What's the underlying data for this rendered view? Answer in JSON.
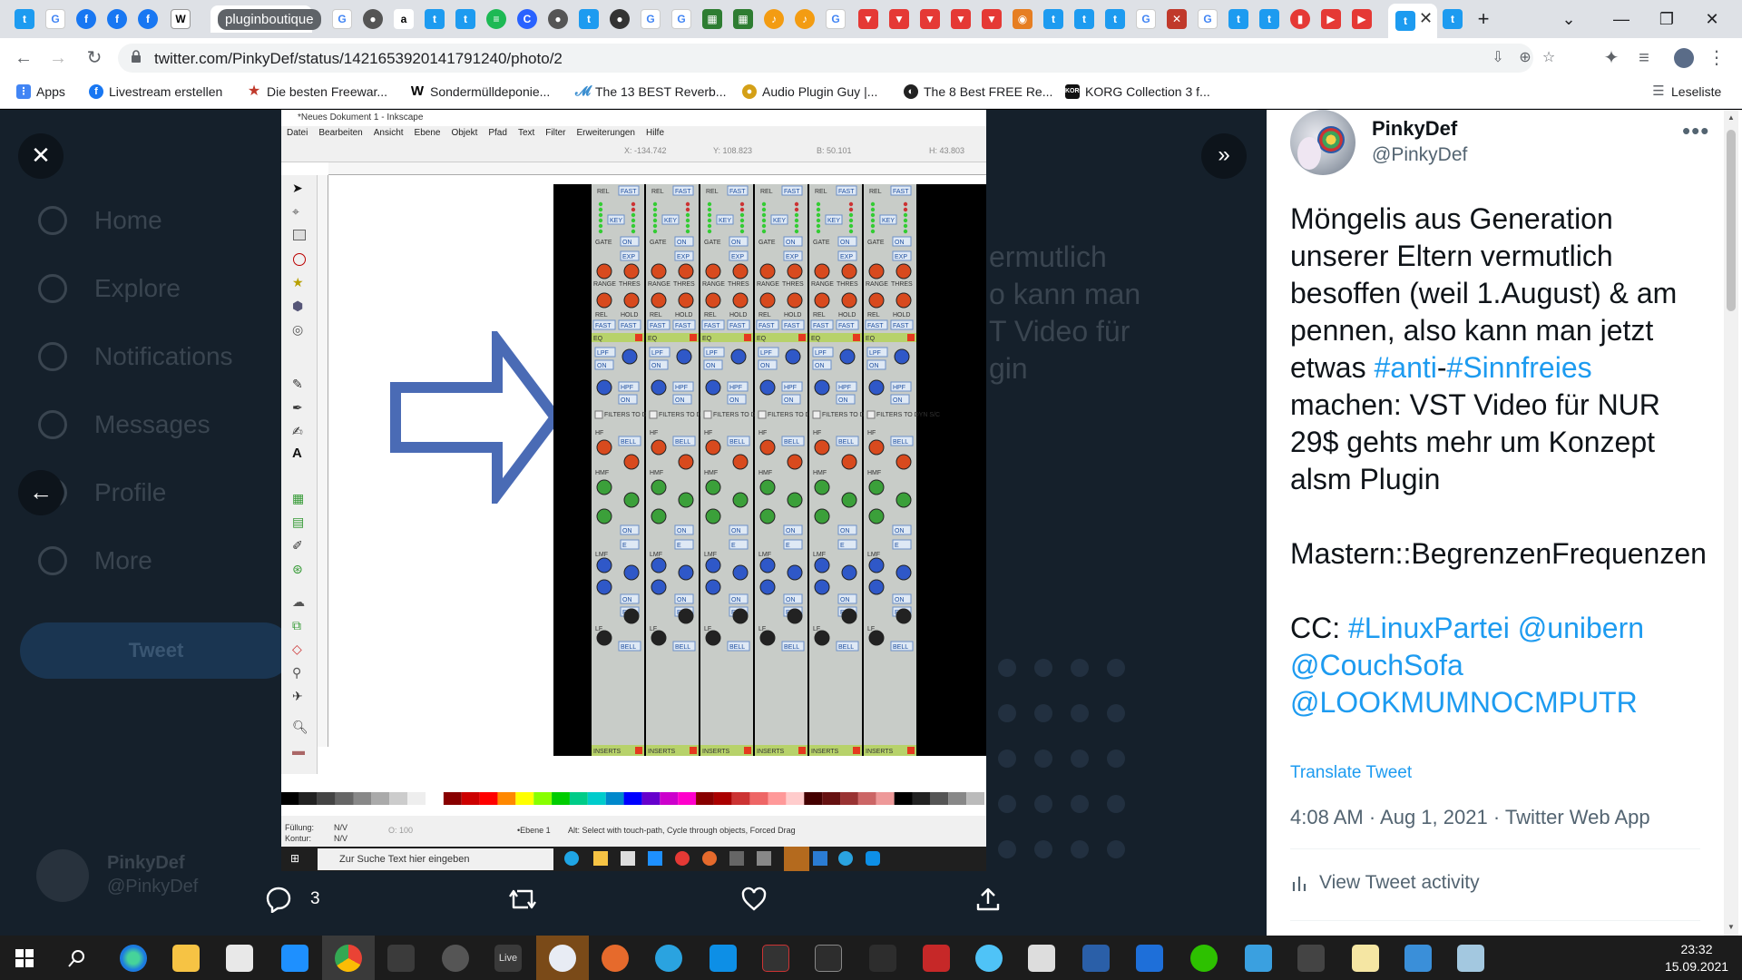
{
  "browser": {
    "active_tab_label": "pluginboutique",
    "url": "twitter.com/PinkyDef/status/1421653920141791240/photo/2",
    "bookmarks": [
      {
        "label": "Apps",
        "icon": "apps-grid-icon",
        "color": "#4285f4"
      },
      {
        "label": "Livestream erstellen",
        "icon": "facebook-icon",
        "color": "#1877f2"
      },
      {
        "label": "Die besten Freewar...",
        "icon": "star-icon",
        "color": "#c0392b"
      },
      {
        "label": "Sondermülldeponie...",
        "icon": "wikipedia-icon",
        "color": "#000000"
      },
      {
        "label": "The 13 BEST Reverb...",
        "icon": "brand-icon",
        "color": "#3b8ed0"
      },
      {
        "label": "Audio Plugin Guy |...",
        "icon": "brand-icon",
        "color": "#d4a017"
      },
      {
        "label": "The 8 Best FREE Re...",
        "icon": "brand-icon",
        "color": "#222222"
      },
      {
        "label": "KORG Collection 3 f...",
        "icon": "korg-icon",
        "color": "#111111"
      }
    ],
    "reading_list": "Leseliste"
  },
  "photo": {
    "inkscape_title": "*Neues Dokument 1 - Inkscape",
    "menu": [
      "Datei",
      "Bearbeiten",
      "Ansicht",
      "Ebene",
      "Objekt",
      "Pfad",
      "Text",
      "Filter",
      "Erweiterungen",
      "Hilfe"
    ],
    "ctrl_x": "X: -134.742",
    "ctrl_y": "Y: 108.823",
    "ctrl_b": "B: 50.101",
    "ctrl_h": "H: 43.803",
    "status_fill": "Füllung:",
    "status_stroke": "Kontur:",
    "status_fill_val": "N/V",
    "status_stroke_val": "N/V",
    "status_layer": "•Ebene 1",
    "status_hint": "Alt: Select with touch-path, Cycle through objects, Forced Drag",
    "status_opacity": "O: 100",
    "taskbar_search": "Zur Suche Text hier eingeben",
    "strip_labels": {
      "rel": "REL",
      "fast": "FAST",
      "key": "KEY",
      "gate": "GATE",
      "on": "ON",
      "exp": "EXP",
      "range": "RANGE",
      "thres": "THRES",
      "hold": "HOLD",
      "eq": "EQ",
      "lpf": "LPF",
      "hpf": "HPF",
      "filters": "FILTERS TO DYN S/C",
      "hf": "HF",
      "bell": "BELL",
      "hmf": "HMF",
      "lmf": "LMF",
      "lf": "LF",
      "inserts": "INSERTS",
      "e": "E"
    }
  },
  "photo_actions": {
    "reply_count": "3"
  },
  "dim_background": {
    "nav": [
      "Home",
      "Explore",
      "Notifications",
      "Messages",
      "Profile",
      "More"
    ],
    "tweet_button": "Tweet",
    "user_name": "PinkyDef",
    "user_handle": "@PinkyDef",
    "text_lines": [
      "ermutlich",
      "o kann man",
      "T Video für",
      "gin"
    ]
  },
  "tweet": {
    "display_name": "PinkyDef",
    "handle": "@PinkyDef",
    "text_part1": "Möngelis aus Generation unserer Eltern vermutlich besoffen (weil 1.August) & am pennen, also kann man jetzt etwas ",
    "hashtag_anti": "#anti",
    "dash": "-",
    "hashtag_sinnfreies": "#Sinnfreies",
    "text_part2": " machen: VST Video für NUR 29$ gehts mehr um Konzept alsm Plugin\n\nMastern::BegrenzenFrequenzen\n\nCC: ",
    "hashtag_linuxpartei": "#LinuxPartei",
    "mention_unibern": "@unibern",
    "mention_couchsofa": "@CouchSofa",
    "mention_lookmumno": "@LOOKMUMNOCMPUTR",
    "translate": "Translate Tweet",
    "timestamp": "4:08 AM · Aug 1, 2021 · Twitter Web App",
    "activity": "View Tweet activity"
  },
  "taskbar": {
    "time": "23:32",
    "date": "15.09.2021"
  },
  "colors": {
    "twitter_blue": "#1d9bf0",
    "dim_bg": "#15202b",
    "arrow_blue": "#4a6bb5"
  }
}
